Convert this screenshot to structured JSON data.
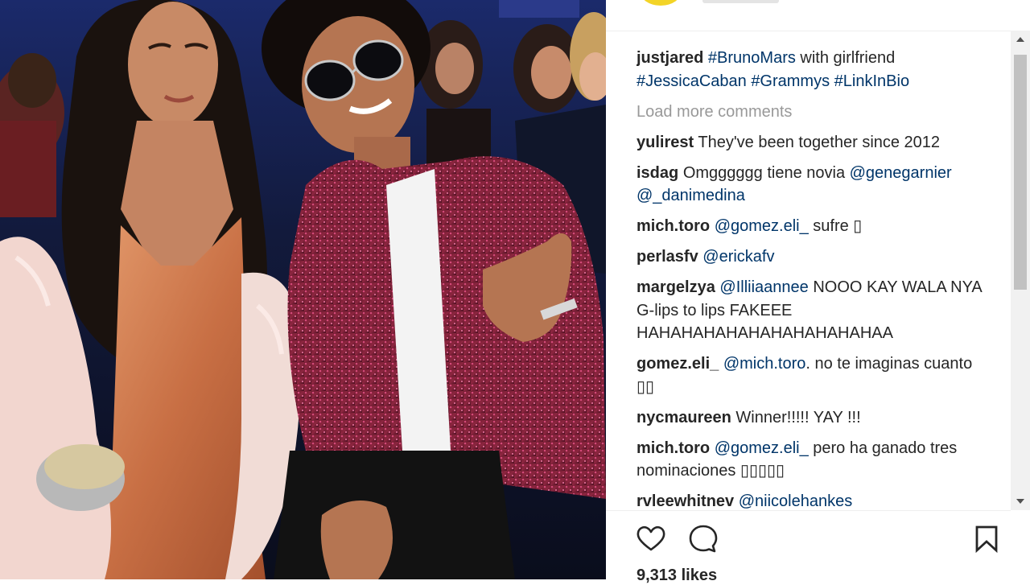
{
  "post": {
    "author": "justjared",
    "caption_parts": [
      {
        "text": "#BrunoMars",
        "tag": true
      },
      {
        "text": " with girlfriend ",
        "tag": false
      },
      {
        "text": "#JessicaCaban",
        "tag": true
      },
      {
        "text": " ",
        "tag": false
      },
      {
        "text": "#Grammys",
        "tag": true
      },
      {
        "text": " ",
        "tag": false
      },
      {
        "text": "#LinkInBio",
        "tag": true
      }
    ]
  },
  "load_more_label": "Load more comments",
  "comments": [
    {
      "user": "yulirest",
      "parts": [
        {
          "text": "They've been together since 2012",
          "tag": false
        }
      ]
    },
    {
      "user": "isdag",
      "parts": [
        {
          "text": "Omgggggg tiene novia ",
          "tag": false
        },
        {
          "text": "@genegarnier",
          "tag": true
        },
        {
          "text": " ",
          "tag": false
        },
        {
          "text": "@_danimedina",
          "tag": true
        }
      ]
    },
    {
      "user": "mich.toro",
      "parts": [
        {
          "text": "@gomez.eli_",
          "tag": true
        },
        {
          "text": " sufre ▯",
          "tag": false
        }
      ]
    },
    {
      "user": "perlasfv",
      "parts": [
        {
          "text": "@erickafv",
          "tag": true
        }
      ]
    },
    {
      "user": "margelzya",
      "parts": [
        {
          "text": "@Illiiaannee",
          "tag": true
        },
        {
          "text": " NOOO KAY WALA NYA G-lips to lips FAKEEE HAHAHAHAHAHAHAHAHAHAHAA",
          "tag": false
        }
      ]
    },
    {
      "user": "gomez.eli_",
      "parts": [
        {
          "text": "@mich.toro",
          "tag": true
        },
        {
          "text": ". no te imaginas cuanto ▯▯",
          "tag": false
        }
      ]
    },
    {
      "user": "nycmaureen",
      "parts": [
        {
          "text": "Winner!!!!! YAY !!!",
          "tag": false
        }
      ]
    },
    {
      "user": "mich.toro",
      "parts": [
        {
          "text": "@gomez.eli_",
          "tag": true
        },
        {
          "text": " pero ha ganado tres nominaciones ▯▯▯▯▯",
          "tag": false
        }
      ]
    },
    {
      "user": "rvleewhitnev",
      "parts": [
        {
          "text": "@niicolehankes",
          "tag": true
        }
      ]
    }
  ],
  "actions": {
    "like_icon": "heart-outline-icon",
    "comment_icon": "speech-bubble-icon",
    "save_icon": "bookmark-icon"
  },
  "likes_label": "9,313 likes",
  "colors": {
    "link": "#003569",
    "text": "#262626",
    "muted": "#999999",
    "avatar": "#f3d427"
  }
}
